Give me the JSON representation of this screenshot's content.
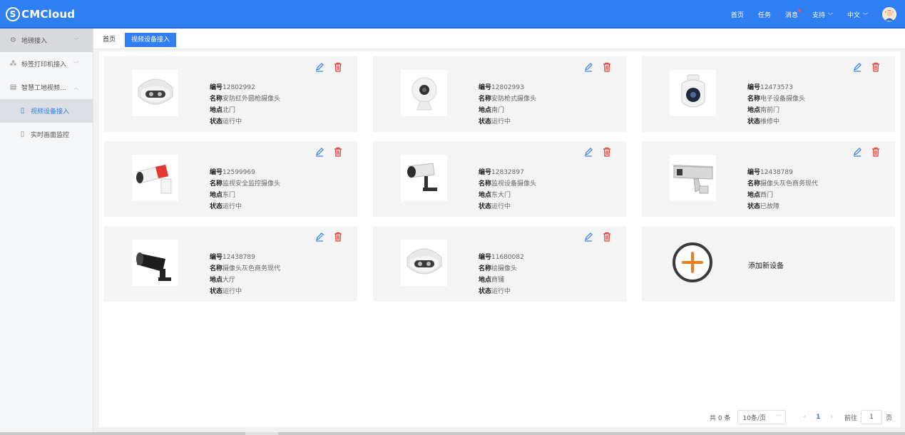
{
  "header": {
    "logo_text": "CMCloud",
    "nav": {
      "home": "首页",
      "tasks": "任务",
      "messages": "消息",
      "support": "支持",
      "language": "中文"
    }
  },
  "sidebar": {
    "items": [
      {
        "label": "地磅接入"
      },
      {
        "label": "标签打印机接入"
      },
      {
        "label": "智慧工地视频..."
      },
      {
        "label": "视频设备接入"
      },
      {
        "label": "实时画面监控"
      }
    ]
  },
  "tabs": [
    {
      "label": "首页"
    },
    {
      "label": "视频设备接入"
    }
  ],
  "labels": {
    "id": "编号",
    "name": "名称",
    "location": "地点",
    "status": "状态"
  },
  "devices": [
    {
      "id": "12802992",
      "name": "安防红外圆枪摄像头",
      "location": "北门",
      "status": "运行中",
      "icon": "dome-camera"
    },
    {
      "id": "12802993",
      "name": "安防枪式摄像头",
      "location": "南门",
      "status": "运行中",
      "icon": "webcam"
    },
    {
      "id": "12473573",
      "name": "电子设备摄像头",
      "location": "南前门",
      "status": "维修中",
      "icon": "ptz-camera"
    },
    {
      "id": "12599969",
      "name": "监视安全监控摄像头",
      "location": "东门",
      "status": "运行中",
      "icon": "red-bullet-camera"
    },
    {
      "id": "12832897",
      "name": "监视设备摄像头",
      "location": "东大门",
      "status": "运行中",
      "icon": "wall-bullet-camera"
    },
    {
      "id": "12438789",
      "name": "摄像头灰色商务现代",
      "location": "西门",
      "status": "已故障",
      "icon": "gray-box-camera"
    },
    {
      "id": "12438789",
      "name": "摄像头灰色商务现代",
      "location": "大厅",
      "status": "运行中",
      "icon": "black-bullet-camera"
    },
    {
      "id": "11680082",
      "name": "绘摄像头",
      "location": "商铺",
      "status": "运行中",
      "icon": "dome-camera"
    }
  ],
  "add_card": {
    "label": "添加新设备"
  },
  "pagination": {
    "total": "共 0 条",
    "page_size": "10条/页",
    "current_page": "1",
    "goto_label": "前往",
    "goto_value": "1",
    "page_suffix": "页"
  },
  "colors": {
    "primary": "#2f7ef2",
    "edit_icon": "#2f7ef2",
    "delete_icon": "#e53935",
    "add_icon": "#f07c1e"
  }
}
